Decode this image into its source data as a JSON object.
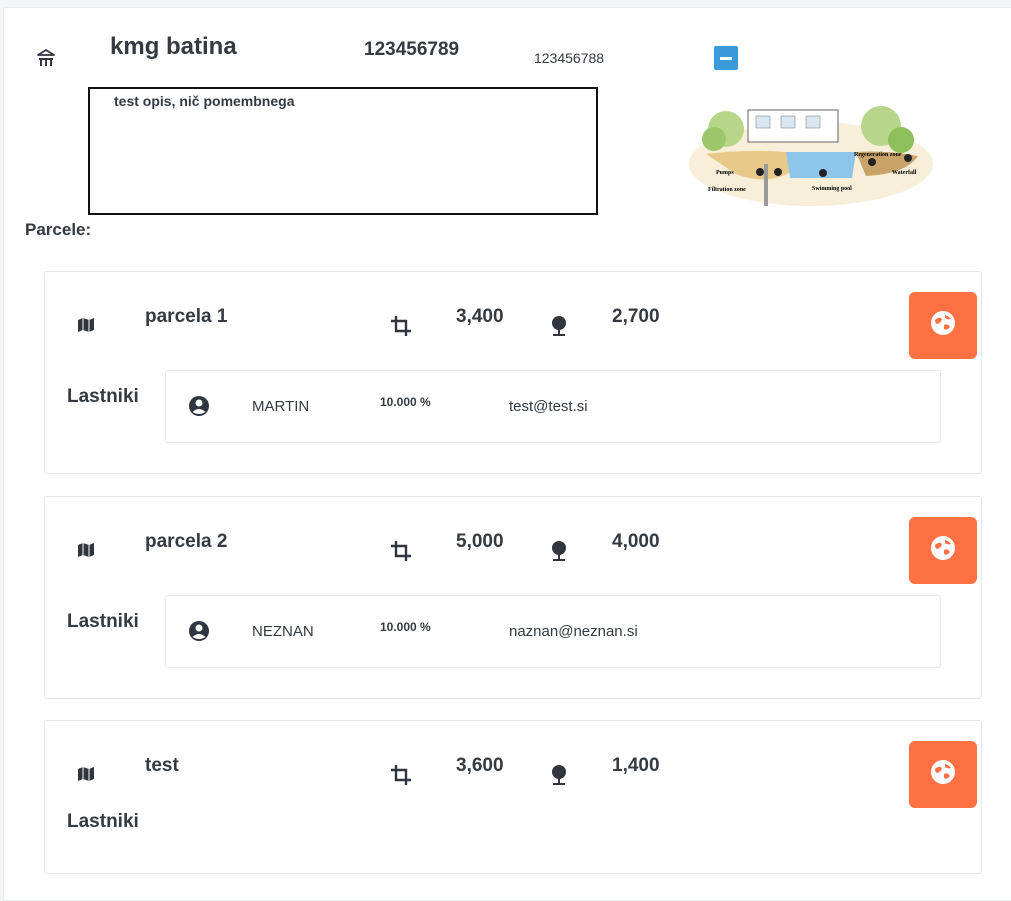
{
  "header": {
    "title": "kmg batina",
    "number_primary": "123456789",
    "number_secondary": "123456788",
    "description": "test opis, nič pomembnega",
    "home_icon": "building-icon",
    "collapse_icon": "minus-icon",
    "diagram_labels": {
      "pumps": "Pumps",
      "filtration": "Filtration zone",
      "swimming": "Swimming pool",
      "regeneration": "Regeneration zone",
      "waterfall": "Waterfall"
    }
  },
  "parcels_label": "Parcele:",
  "colors": {
    "accent_orange": "#ff7043",
    "accent_blue": "#3a9ad9"
  },
  "parcels": [
    {
      "name": "parcela 1",
      "area": "3,400",
      "trees": "2,700",
      "owners_label": "Lastniki",
      "owners": [
        {
          "name": "MARTIN",
          "share": "10.000 %",
          "email": "test@test.si"
        }
      ]
    },
    {
      "name": "parcela 2",
      "area": "5,000",
      "trees": "4,000",
      "owners_label": "Lastniki",
      "owners": [
        {
          "name": "NEZNAN",
          "share": "10.000 %",
          "email": "naznan@neznan.si"
        }
      ]
    },
    {
      "name": "test",
      "area": "3,600",
      "trees": "1,400",
      "owners_label": "Lastniki",
      "owners": []
    }
  ]
}
